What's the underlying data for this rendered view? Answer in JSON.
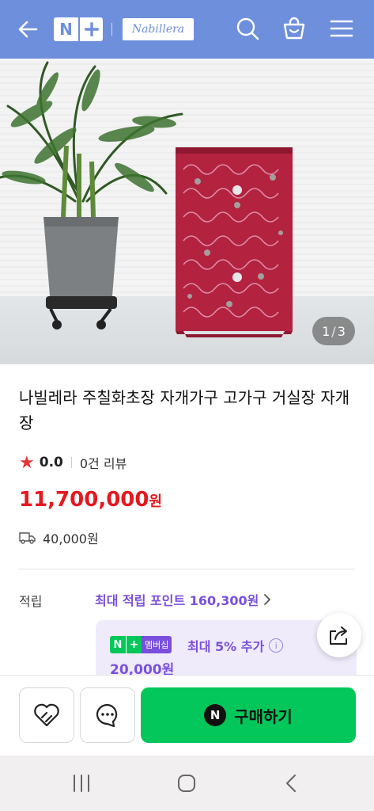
{
  "header": {
    "brand_name": "Nabillera",
    "npay_letter": "N"
  },
  "hero": {
    "counter_current": "1",
    "counter_total": "3"
  },
  "product": {
    "title": "나빌레라 주칠화초장 자개가구 고가구 거실장 자개장",
    "rating_score": "0.0",
    "review_text": "0건 리뷰",
    "price": "11,700,000",
    "price_unit": "원",
    "shipping_fee": "40,000원"
  },
  "points": {
    "label": "적립",
    "link_text": "최대 적립 포인트 160,300원",
    "membership_badge": "멤버십",
    "membership_text": "최대 5% 추가",
    "membership_amount": "20,000원"
  },
  "actions": {
    "buy_label": "구매하기",
    "buy_icon_letter": "N"
  },
  "colors": {
    "header_bg": "#6e8fdc",
    "price": "#e4181f",
    "accent_purple": "#7a4fdc",
    "buy_green": "#03c75a"
  },
  "icons": [
    "back-arrow-icon",
    "search-icon",
    "shopping-bag-icon",
    "hamburger-menu-icon",
    "star-icon",
    "truck-icon",
    "chevron-right-icon",
    "info-icon",
    "share-icon",
    "wishlist-heart-icon",
    "chat-icon",
    "recent-apps-icon",
    "home-icon",
    "system-back-icon"
  ]
}
